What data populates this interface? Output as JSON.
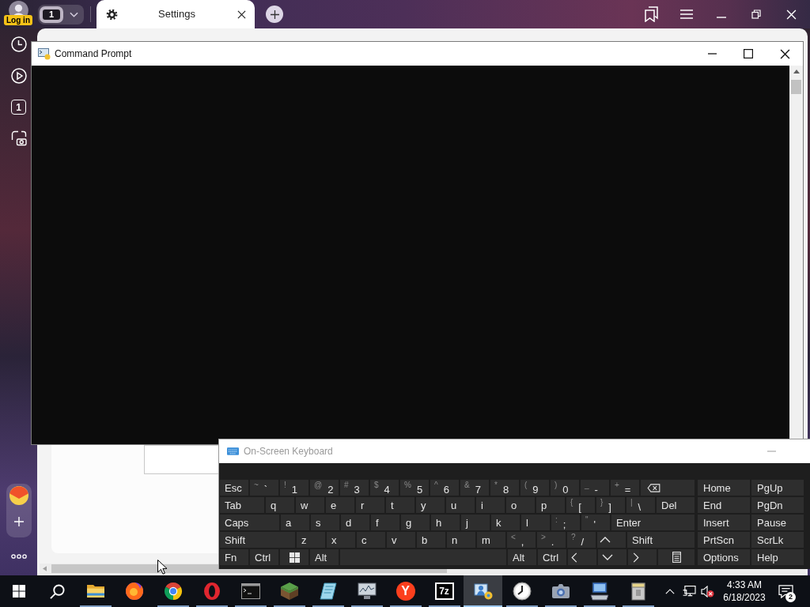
{
  "browser": {
    "login_badge": "Log in",
    "tab_counter": "1",
    "tabs": [
      {
        "title": "Settings",
        "selected": true
      }
    ],
    "sidebar": {
      "tab_count": "1"
    }
  },
  "command_prompt": {
    "title": "Command Prompt",
    "active": true
  },
  "on_screen_keyboard": {
    "title": "On-Screen Keyboard",
    "active": false,
    "rows": [
      {
        "keys": [
          {
            "kind": "text",
            "label": "Esc"
          },
          {
            "kind": "dual",
            "shift": "~",
            "label": "`"
          },
          {
            "kind": "dual",
            "shift": "!",
            "label": "1"
          },
          {
            "kind": "dual",
            "shift": "@",
            "label": "2"
          },
          {
            "kind": "dual",
            "shift": "#",
            "label": "3"
          },
          {
            "kind": "dual",
            "shift": "$",
            "label": "4"
          },
          {
            "kind": "dual",
            "shift": "%",
            "label": "5"
          },
          {
            "kind": "dual",
            "shift": "^",
            "label": "6"
          },
          {
            "kind": "dual",
            "shift": "&",
            "label": "7"
          },
          {
            "kind": "dual",
            "shift": "*",
            "label": "8"
          },
          {
            "kind": "dual",
            "shift": "(",
            "label": "9"
          },
          {
            "kind": "dual",
            "shift": ")",
            "label": "0"
          },
          {
            "kind": "dual",
            "shift": "_",
            "label": "-"
          },
          {
            "kind": "dual",
            "shift": "+",
            "label": "="
          },
          {
            "kind": "backspace"
          }
        ],
        "side_keys": [
          "Home",
          "PgUp"
        ]
      },
      {
        "keys": [
          {
            "kind": "text",
            "label": "Tab"
          },
          {
            "kind": "text",
            "label": "q"
          },
          {
            "kind": "text",
            "label": "w"
          },
          {
            "kind": "text",
            "label": "e"
          },
          {
            "kind": "text",
            "label": "r"
          },
          {
            "kind": "text",
            "label": "t"
          },
          {
            "kind": "text",
            "label": "y"
          },
          {
            "kind": "text",
            "label": "u"
          },
          {
            "kind": "text",
            "label": "i"
          },
          {
            "kind": "text",
            "label": "o"
          },
          {
            "kind": "text",
            "label": "p"
          },
          {
            "kind": "dual",
            "shift": "{",
            "label": "["
          },
          {
            "kind": "dual",
            "shift": "}",
            "label": "]"
          },
          {
            "kind": "dual",
            "shift": "|",
            "label": "\\"
          },
          {
            "kind": "text",
            "label": "Del"
          }
        ],
        "side_keys": [
          "End",
          "PgDn"
        ]
      },
      {
        "keys": [
          {
            "kind": "text",
            "label": "Caps"
          },
          {
            "kind": "text",
            "label": "a"
          },
          {
            "kind": "text",
            "label": "s"
          },
          {
            "kind": "text",
            "label": "d"
          },
          {
            "kind": "text",
            "label": "f"
          },
          {
            "kind": "text",
            "label": "g"
          },
          {
            "kind": "text",
            "label": "h"
          },
          {
            "kind": "text",
            "label": "j"
          },
          {
            "kind": "text",
            "label": "k"
          },
          {
            "kind": "text",
            "label": "l"
          },
          {
            "kind": "dual",
            "shift": ":",
            "label": ";"
          },
          {
            "kind": "dual",
            "shift": "\"",
            "label": "'"
          },
          {
            "kind": "text",
            "label": "Enter"
          }
        ],
        "side_keys": [
          "Insert",
          "Pause"
        ]
      },
      {
        "keys": [
          {
            "kind": "text",
            "label": "Shift"
          },
          {
            "kind": "text",
            "label": "z"
          },
          {
            "kind": "text",
            "label": "x"
          },
          {
            "kind": "text",
            "label": "c"
          },
          {
            "kind": "text",
            "label": "v"
          },
          {
            "kind": "text",
            "label": "b"
          },
          {
            "kind": "text",
            "label": "n"
          },
          {
            "kind": "text",
            "label": "m"
          },
          {
            "kind": "dual",
            "shift": "<",
            "label": ","
          },
          {
            "kind": "dual",
            "shift": ">",
            "label": "."
          },
          {
            "kind": "dual",
            "shift": "?",
            "label": "/"
          },
          {
            "kind": "up"
          },
          {
            "kind": "text",
            "label": "Shift"
          }
        ],
        "side_keys": [
          "PrtScn",
          "ScrLk"
        ]
      },
      {
        "keys": [
          {
            "kind": "text",
            "label": "Fn"
          },
          {
            "kind": "text",
            "label": "Ctrl"
          },
          {
            "kind": "windows"
          },
          {
            "kind": "text",
            "label": "Alt"
          },
          {
            "kind": "space"
          },
          {
            "kind": "text",
            "label": "Alt"
          },
          {
            "kind": "text",
            "label": "Ctrl"
          },
          {
            "kind": "left"
          },
          {
            "kind": "down"
          },
          {
            "kind": "right"
          },
          {
            "kind": "menu"
          }
        ],
        "side_keys": [
          "Options",
          "Help"
        ]
      }
    ]
  },
  "taskbar": {
    "apps": [
      {
        "kind": "folder",
        "running": true,
        "selected": false
      },
      {
        "kind": "fox-globe",
        "running": false,
        "selected": false
      },
      {
        "kind": "tricolor-ring",
        "running": true,
        "selected": false
      },
      {
        "kind": "o-ring",
        "running": true,
        "selected": false
      },
      {
        "kind": "terminal",
        "running": true,
        "selected": false
      },
      {
        "kind": "grass-block",
        "running": true,
        "selected": false
      },
      {
        "kind": "tilted-sheet",
        "running": true,
        "selected": false
      },
      {
        "kind": "monitor-chart",
        "running": true,
        "selected": false
      },
      {
        "kind": "letter",
        "text": "Y",
        "running": true,
        "selected": false
      },
      {
        "kind": "tile",
        "text": "7z",
        "running": true,
        "selected": false
      },
      {
        "kind": "person-window",
        "running": true,
        "selected": true
      },
      {
        "kind": "clock-face",
        "running": true,
        "selected": false
      },
      {
        "kind": "camera",
        "running": true,
        "selected": false
      },
      {
        "kind": "monitor-keyboard",
        "running": true,
        "selected": false
      },
      {
        "kind": "archive-box",
        "running": true,
        "selected": false
      }
    ],
    "tray": {
      "time": "4:33 AM",
      "date": "6/18/2023",
      "notification_count": "2"
    }
  }
}
